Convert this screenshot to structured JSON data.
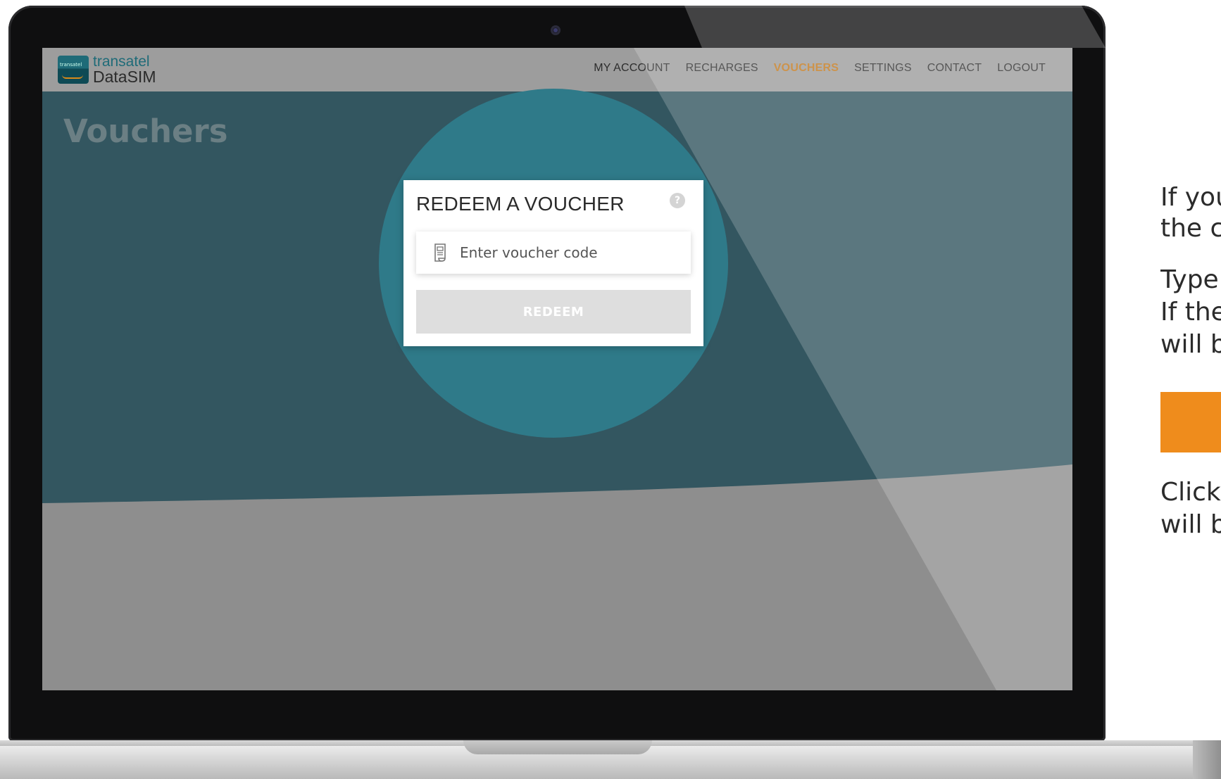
{
  "app": {
    "logo_line1": "transatel",
    "logo_line2": "DataSIM",
    "logo_mark_text": "transatel"
  },
  "nav": {
    "items": [
      {
        "label": "MY ACCOUNT",
        "active": false
      },
      {
        "label": "RECHARGES",
        "active": false
      },
      {
        "label": "VOUCHERS",
        "active": true
      },
      {
        "label": "SETTINGS",
        "active": false
      },
      {
        "label": "CONTACT",
        "active": false
      },
      {
        "label": "LOGOUT",
        "active": false
      }
    ]
  },
  "page": {
    "title": "Vouchers"
  },
  "voucher_card": {
    "title": "REDEEM A VOUCHER",
    "help_icon": "?",
    "input_placeholder": "Enter voucher code",
    "input_icon": "receipt-icon",
    "button_label": "REDEEM"
  },
  "side_text": {
    "line1": "If you",
    "line2": "the c",
    "line3": "Type",
    "line4": "If the",
    "line5": "will b",
    "line6": "Click",
    "line7": "will b"
  },
  "colors": {
    "accent_orange": "#ef8c1c",
    "active_nav": "#c1781e",
    "teal": "#2f7a89"
  }
}
